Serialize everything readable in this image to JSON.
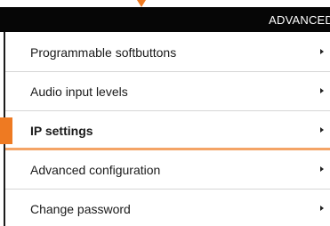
{
  "header": {
    "title": "ADVANCED"
  },
  "menu": {
    "items": [
      {
        "label": "Programmable softbuttons",
        "icon": "chevron-right-icon"
      },
      {
        "label": "Audio input levels",
        "icon": "chevron-right-icon"
      },
      {
        "label": "IP settings",
        "icon": "chevron-right-icon",
        "selected": true
      },
      {
        "label": "Advanced configuration",
        "icon": "chevron-right-icon"
      },
      {
        "label": "Change password",
        "icon": "chevron-right-icon"
      }
    ]
  },
  "colors": {
    "accent": "#ee7a22",
    "header_bg": "#060606",
    "text": "#1a1a1a"
  }
}
